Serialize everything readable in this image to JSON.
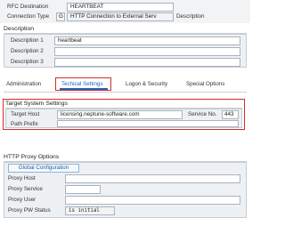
{
  "header": {
    "rfc_destination_label": "RFC Destination",
    "rfc_destination_value": "HEARTBEAT",
    "connection_type_label": "Connection Type",
    "connection_type_code": "G",
    "connection_type_value": "HTTP Connection to External Serv",
    "description_suffix": "Description"
  },
  "description": {
    "title": "Description",
    "rows": [
      {
        "label": "Description 1",
        "value": "heartbeat"
      },
      {
        "label": "Description 2",
        "value": ""
      },
      {
        "label": "Description 3",
        "value": ""
      }
    ]
  },
  "tabs": [
    {
      "label": "Administration",
      "active": false
    },
    {
      "label": "Techical Settings",
      "active": true
    },
    {
      "label": "Logon & Security",
      "active": false
    },
    {
      "label": "Special Options",
      "active": false
    }
  ],
  "target": {
    "title": "Target System Settings",
    "host_label": "Target Host",
    "host_value": "licensing.neptune-software.com",
    "service_label": "Service No.",
    "service_value": "443",
    "path_label": "Path Prefix",
    "path_value": ""
  },
  "proxy": {
    "title": "HTTP Proxy Options",
    "global_button": "Global Configuration",
    "rows": [
      {
        "label": "Proxy Host",
        "value": ""
      },
      {
        "label": "Proxy Service",
        "value": ""
      },
      {
        "label": "Proxy User",
        "value": ""
      },
      {
        "label": "Proxy PW Status",
        "value": "is initial"
      }
    ]
  },
  "colors": {
    "highlight": "#d62b2b",
    "active_tab": "#1f66b3"
  }
}
